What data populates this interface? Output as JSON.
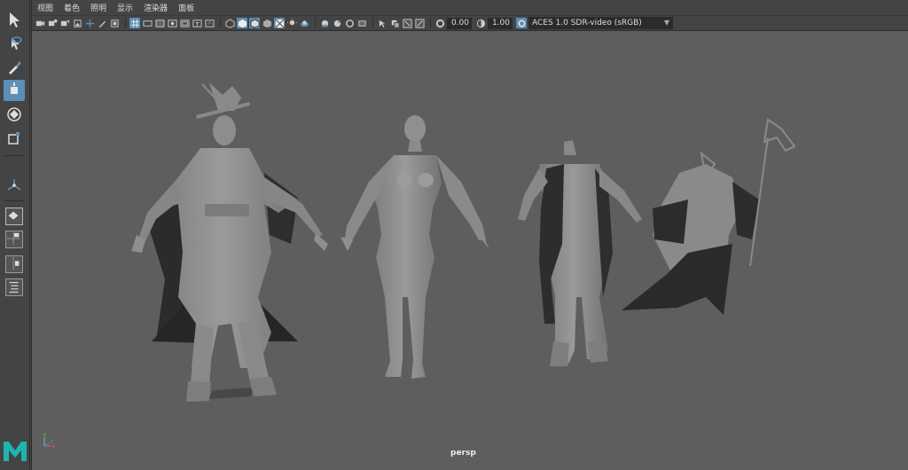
{
  "menu": [
    "视图",
    "着色",
    "照明",
    "显示",
    "渲染器",
    "面板"
  ],
  "toolbar": {
    "exposure_value": "0.00",
    "gamma_value": "1.00",
    "color_space": "ACES 1.0 SDR-video (sRGB)"
  },
  "viewport": {
    "camera_label": "persp"
  },
  "toolbox": {
    "tools": [
      "select-tool",
      "lasso-tool",
      "paint-select-tool",
      "move-tool",
      "rotate-tool",
      "scale-tool",
      "manipulator-tool"
    ]
  },
  "colors": {
    "viewport_bg": "#5e5e5e",
    "ui_bg": "#444444",
    "highlight": "#5d8fb6",
    "model": "#8c8c8c"
  }
}
